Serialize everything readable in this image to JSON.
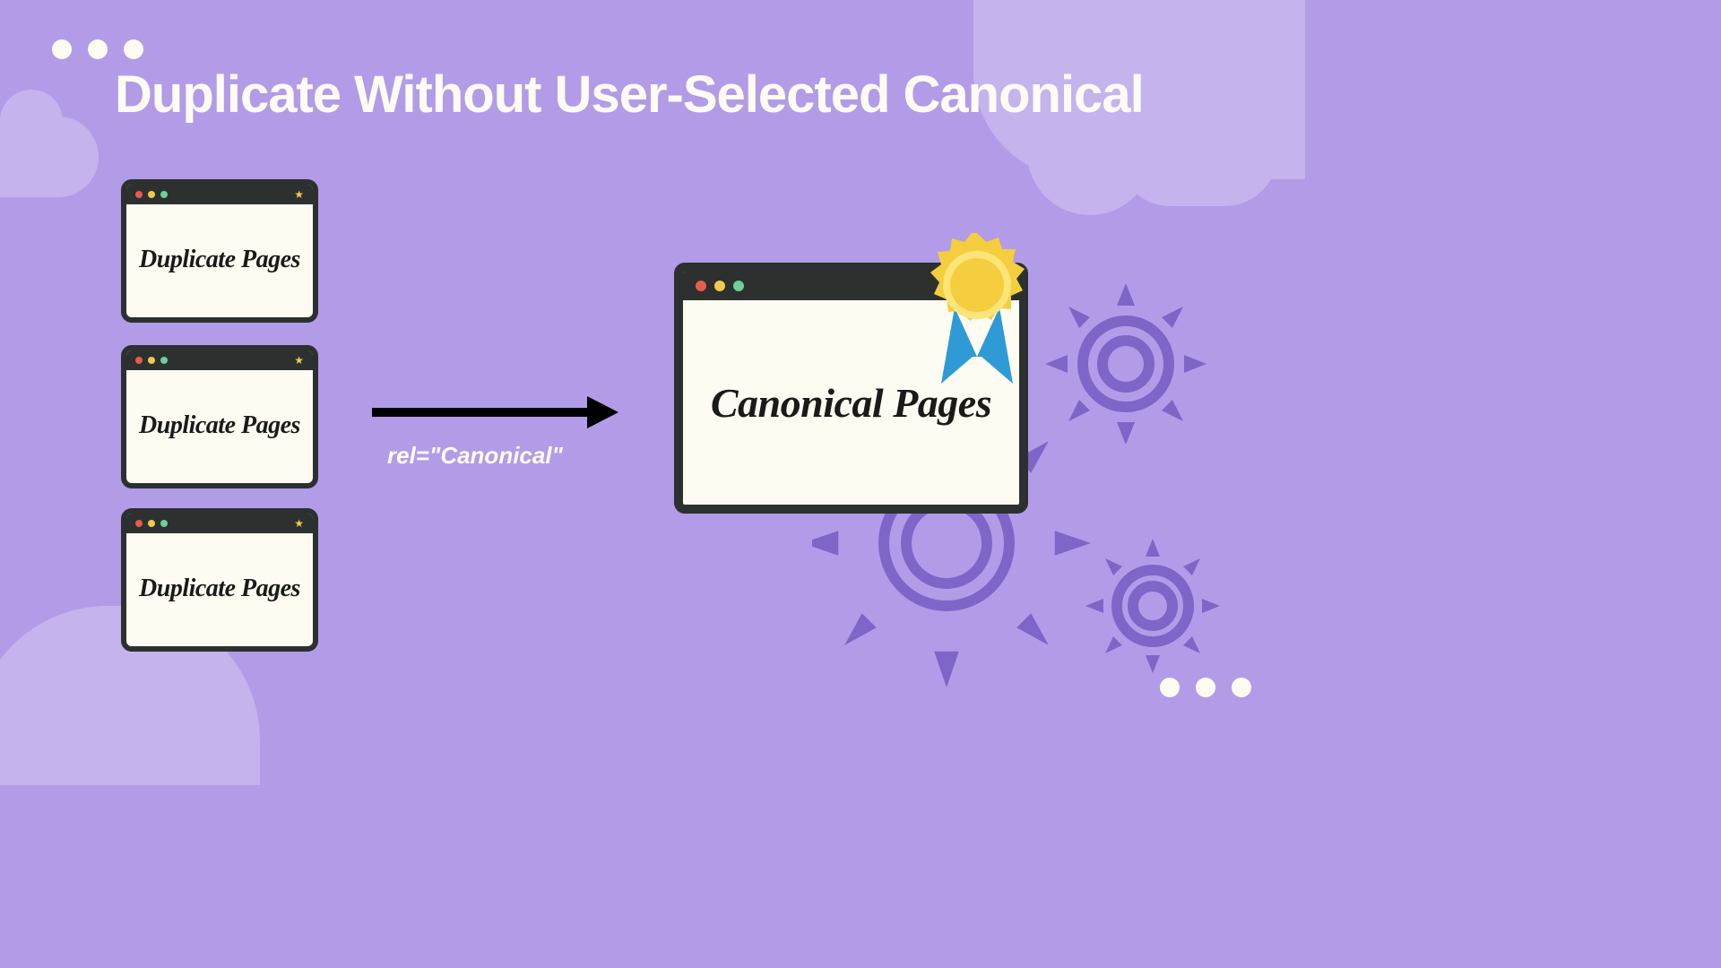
{
  "title": "Duplicate Without User-Selected Canonical",
  "duplicate_windows": [
    {
      "label": "Duplicate Pages"
    },
    {
      "label": "Duplicate Pages"
    },
    {
      "label": "Duplicate Pages"
    }
  ],
  "canonical_window": {
    "label": "Canonical Pages"
  },
  "arrow_label": "rel=\"Canonical\"",
  "colors": {
    "background": "#B29CE8",
    "cloud": "#C5B3EE",
    "white": "#FEFBF2",
    "window_frame": "#2C3130",
    "traffic_red": "#E85C4A",
    "traffic_yellow": "#F2C94C",
    "traffic_green": "#6FCF97",
    "badge_gold": "#F4CE3E",
    "badge_ribbon": "#2E9BD6",
    "gear_outline": "#7E66C8"
  }
}
